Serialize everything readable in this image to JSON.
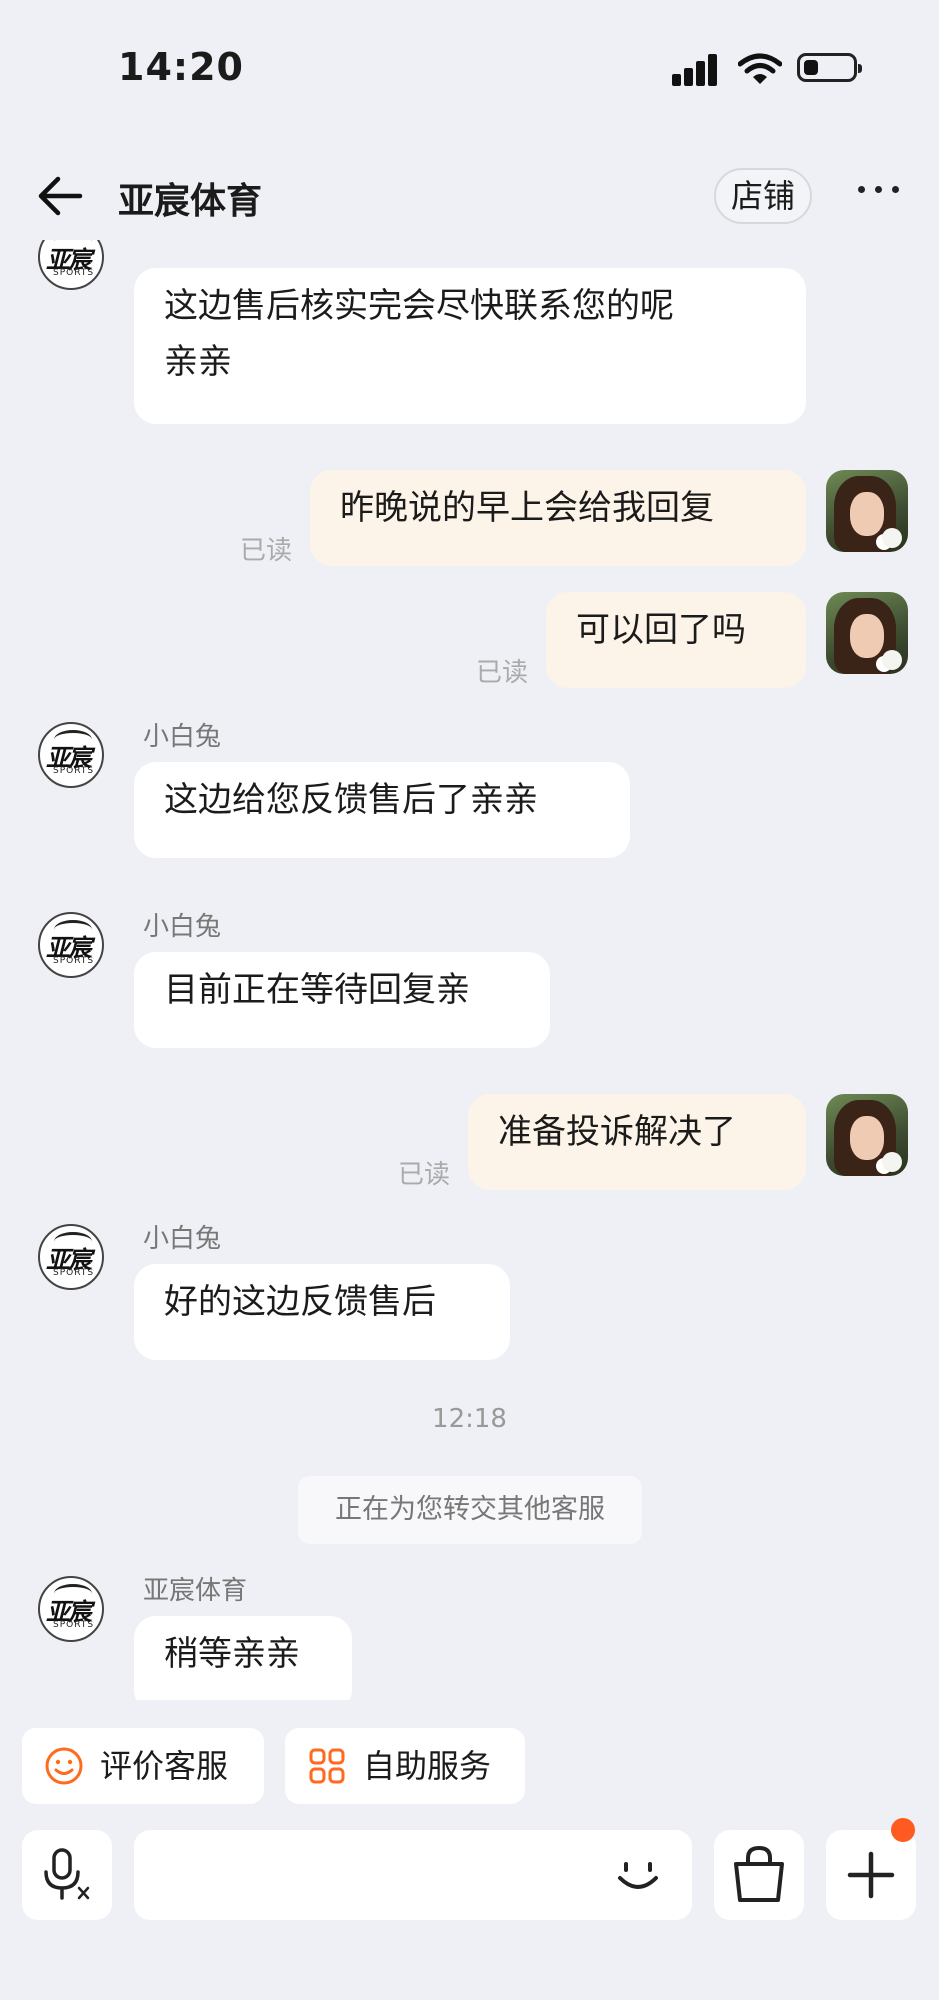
{
  "status_bar": {
    "time": "14:20"
  },
  "header": {
    "title": "亚宸体育",
    "shop_button": "店铺"
  },
  "messages": {
    "m1": {
      "text_line1": "这边售后核实完会尽快联系您的呢",
      "text_line2": "亲亲"
    },
    "m2": {
      "text": "昨晚说的早上会给我回复",
      "status": "已读"
    },
    "m3": {
      "text": "可以回了吗",
      "status": "已读"
    },
    "m4": {
      "sender": "小白兔",
      "text": "这边给您反馈售后了亲亲"
    },
    "m5": {
      "sender": "小白兔",
      "text": "目前正在等待回复亲"
    },
    "m6": {
      "text": "准备投诉解决了",
      "status": "已读"
    },
    "m7": {
      "sender": "小白兔",
      "text": "好的这边反馈售后"
    },
    "timestamp": "12:18",
    "system_notice": "正在为您转交其他客服",
    "m8": {
      "sender": "亚宸体育",
      "text": "稍等亲亲"
    }
  },
  "shop_logo": {
    "text": "亚宸",
    "subtext": "SPORTS"
  },
  "quick_actions": {
    "rate": "评价客服",
    "self_service": "自助服务"
  },
  "colors": {
    "accent": "#ff6a1f",
    "my_bubble": "#fdf4e9",
    "background": "#eef0f5"
  },
  "icons": [
    "back-arrow-icon",
    "more-dots-icon",
    "smile-icon",
    "grid-icon",
    "voice-icon",
    "emoji-icon",
    "bag-icon",
    "plus-icon"
  ]
}
